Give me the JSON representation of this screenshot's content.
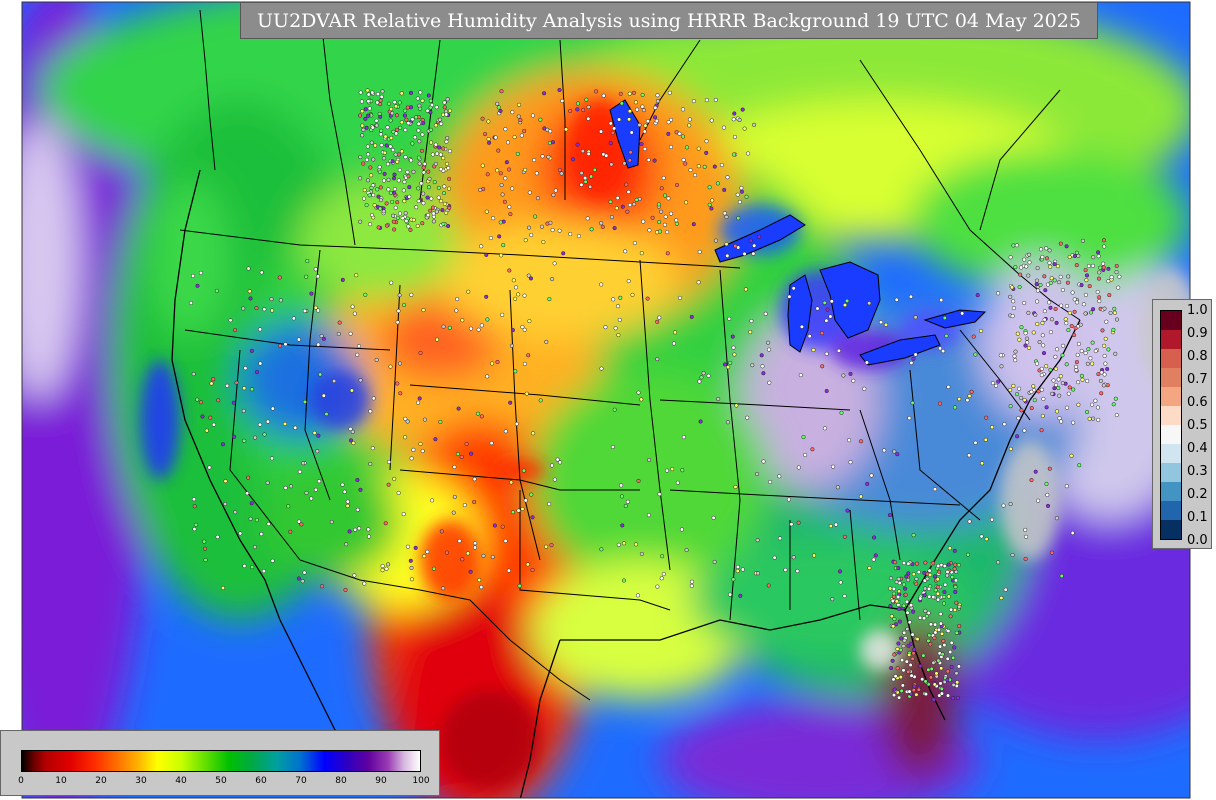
{
  "title": "UU2DVAR Relative Humidity Analysis using HRRR Background 19 UTC 04 May 2025",
  "legend_bottom": {
    "ticks": [
      "0",
      "10",
      "20",
      "30",
      "40",
      "50",
      "60",
      "70",
      "80",
      "90",
      "100"
    ]
  },
  "legend_right": {
    "ticks": [
      "1.0",
      "0.9",
      "0.8",
      "0.7",
      "0.6",
      "0.5",
      "0.4",
      "0.3",
      "0.2",
      "0.1",
      "0.0"
    ],
    "colors": [
      "#67001f",
      "#b2182b",
      "#d6604d",
      "#e08060",
      "#f4a582",
      "#fddbc7",
      "#f7f7f7",
      "#d1e5f0",
      "#92c5de",
      "#4393c3",
      "#2166ac",
      "#053061"
    ]
  },
  "colors": {
    "title_bg": "#8c8c8c",
    "panel_bg": "#c8c8c8",
    "missing": "#c8c8c8",
    "ocean_blue": "#0055ff",
    "moist_purple": "#7a00c8",
    "dry_red": "#e00000",
    "orange": "#ff8c00",
    "yellow": "#ffff00",
    "green": "#00c000"
  }
}
